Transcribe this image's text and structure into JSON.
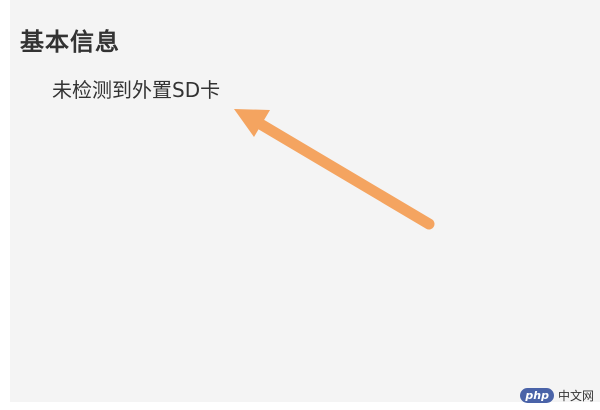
{
  "section": {
    "title": "基本信息"
  },
  "storage": {
    "status_text": "未检测到外置SD卡"
  },
  "annotation": {
    "arrow_color": "#f4a460",
    "icon": "arrow-pointer-icon"
  },
  "watermark": {
    "badge": "php",
    "text": "中文网"
  },
  "colors": {
    "background": "#f4f4f4",
    "text": "#333333"
  }
}
